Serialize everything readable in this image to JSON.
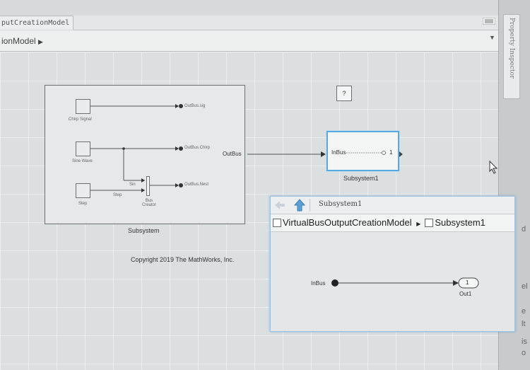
{
  "editor": {
    "tab_title": "putCreationModel",
    "breadcrumb": "ionModel"
  },
  "property_inspector": {
    "label": "Property Inspector",
    "edge_texts": [
      "d",
      "el",
      "e",
      "lt",
      "is",
      "o"
    ]
  },
  "model": {
    "subsystem": {
      "name": "Subsystem",
      "sources": {
        "chirp": "Chirp Signal",
        "sine": "Sine Wave",
        "step": "Step"
      },
      "signals": {
        "sin": "Sin",
        "step": "Step"
      },
      "bus_creator": "Bus\nCreator",
      "outputs": [
        "OutBus.sig",
        "OutBus.Chirp",
        "OutBus.Nest"
      ]
    },
    "outbus_label": "OutBus",
    "unknown_block": "?",
    "subsystem1": {
      "name": "Subsystem1",
      "port_in": "InBus",
      "port_out": "1"
    },
    "copyright": "Copyright 2019 The MathWorks, Inc."
  },
  "subwindow": {
    "title": "Subsystem1",
    "crumb_model": "VirtualBusOutputCreationModel",
    "crumb_sub": "Subsystem1",
    "inport_label": "InBus",
    "outport_number": "1",
    "outport_label": "Out1"
  }
}
